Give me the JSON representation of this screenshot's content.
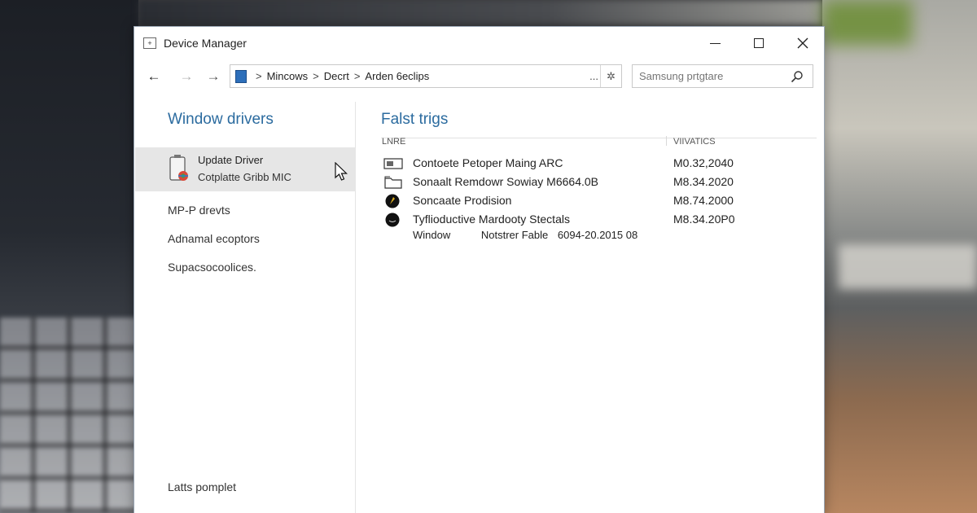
{
  "window": {
    "title": "Device Manager"
  },
  "address_bar": {
    "crumbs": [
      "Mincows",
      "Decrt",
      "Arden 6eclips"
    ],
    "separator": ">",
    "more": "...",
    "search_placeholder": "Samsung prtgtare"
  },
  "left_pane": {
    "heading": "Window drivers",
    "selected_item": {
      "line1": "Update Driver",
      "line2": "Cotplatte Gribb MIC"
    },
    "links": [
      "MP-P drevts",
      "Adnamal ecoptors",
      "Supacsocoolices."
    ],
    "footer": "Latts pomplet"
  },
  "right_pane": {
    "heading": "Falst trigs",
    "columns": {
      "name": "LNRE",
      "version": "VIIVATICS"
    },
    "rows": [
      {
        "name": "Contoete Petoper Maing ARC",
        "version": "M0.32,2040",
        "icon": "device-card-icon"
      },
      {
        "name": "Sonaalt Remdowr Sowiay M6664.0B",
        "version": "M8.34.2020",
        "icon": "device-folder-icon"
      },
      {
        "name": "Soncaate Prodision",
        "version": "M8.74.2000",
        "icon": "device-disc-icon"
      },
      {
        "name": "Tyflioductive Mardooty Stectals",
        "version": "M8.34.20P0",
        "icon": "device-disc-icon"
      }
    ],
    "extra_row": {
      "col1": "Window",
      "col2": "Notstrer Fable",
      "col3": "6094-20.2015 08"
    }
  },
  "colors": {
    "heading_blue": "#2b6b9f",
    "selection_gray": "#e6e6e6",
    "address_icon_blue": "#2d6fba"
  }
}
